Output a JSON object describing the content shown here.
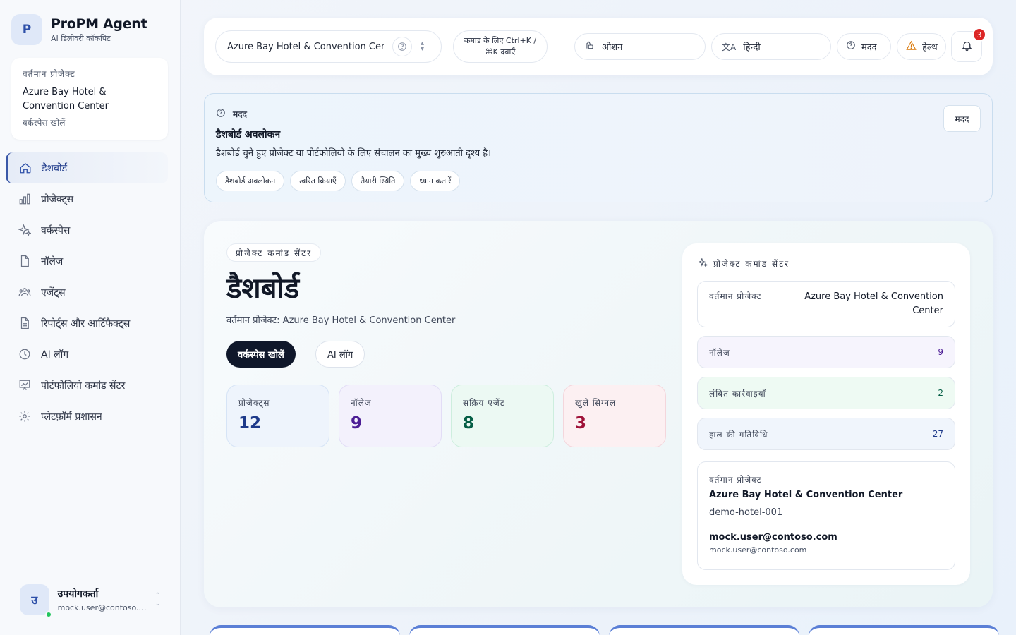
{
  "brand": {
    "logo_letter": "P",
    "title": "ProPM Agent",
    "subtitle": "AI डिलीवरी कॉकपिट"
  },
  "sidebar_card": {
    "label": "वर्तमान प्रोजेक्ट",
    "project_name": "Azure Bay Hotel & Convention Center",
    "open_workspace": "वर्कस्पेस खोलें"
  },
  "nav": [
    {
      "label": "डैशबोर्ड",
      "icon": "home-icon",
      "active": true
    },
    {
      "label": "प्रोजेक्ट्स",
      "icon": "bar-chart-icon",
      "active": false
    },
    {
      "label": "वर्कस्पेस",
      "icon": "sparkles-icon",
      "active": false
    },
    {
      "label": "नॉलेज",
      "icon": "file-icon",
      "active": false
    },
    {
      "label": "एजेंट्स",
      "icon": "users-icon",
      "active": false
    },
    {
      "label": "रिपोर्ट्स और आर्टिफैक्ट्स",
      "icon": "file-text-icon",
      "active": false
    },
    {
      "label": "AI लॉग",
      "icon": "clock-icon",
      "active": false
    },
    {
      "label": "पोर्टफोलियो कमांड सेंटर",
      "icon": "presentation-chart-icon",
      "active": false
    },
    {
      "label": "प्लेटफ़ॉर्म प्रशासन",
      "icon": "gear-icon",
      "active": false
    }
  ],
  "user": {
    "initial": "उ",
    "name": "उपयोगकर्ता",
    "email": "mock.user@contoso.com"
  },
  "topbar": {
    "project_select": "Azure Bay Hotel & Convention Center",
    "command_hint": "कमांड के लिए Ctrl+K / ⌘K दबाएँ",
    "theme": "ओशन",
    "language": "हिन्दी",
    "help": "मदद",
    "health": "हेल्थ",
    "notifications_count": "3"
  },
  "help_panel": {
    "header": "मदद",
    "title": "डैशबोर्ड अवलोकन",
    "description": "डैशबोर्ड चुने हुए प्रोजेक्ट या पोर्टफोलियो के लिए संचालन का मुख्य शुरुआती दृश्य है।",
    "chips": [
      "डैशबोर्ड अवलोकन",
      "त्वरित क्रियाएँ",
      "तैयारी स्थिति",
      "ध्यान कतारें"
    ],
    "button": "मदद"
  },
  "command_center": {
    "pill": "प्रोजेक्ट कमांड सेंटर",
    "title": "डैशबोर्ड",
    "subtitle": "वर्तमान प्रोजेक्ट: Azure Bay Hotel & Convention Center",
    "primary_button": "वर्कस्पेस खोलें",
    "secondary_button": "AI लॉग",
    "stats": [
      {
        "label": "प्रोजेक्ट्स",
        "value": "12"
      },
      {
        "label": "नॉलेज",
        "value": "9"
      },
      {
        "label": "सक्रिय एजेंट",
        "value": "8"
      },
      {
        "label": "खुले सिग्नल",
        "value": "3"
      }
    ]
  },
  "right_card": {
    "header": "प्रोजेक्ट कमांड सेंटर",
    "rows": [
      {
        "key": "वर्तमान प्रोजेक्ट",
        "value": "Azure Bay Hotel & Convention Center"
      },
      {
        "key": "नॉलेज",
        "value": "9"
      },
      {
        "key": "लंबित कार्रवाइयाँ",
        "value": "2"
      },
      {
        "key": "हाल की गतिविधि",
        "value": "27"
      }
    ],
    "detail": {
      "label": "वर्तमान प्रोजेक्ट",
      "project_name": "Azure Bay Hotel & Convention Center",
      "project_id": "demo-hotel-001",
      "user": "mock.user@contoso.com",
      "email": "mock.user@contoso.com"
    }
  }
}
